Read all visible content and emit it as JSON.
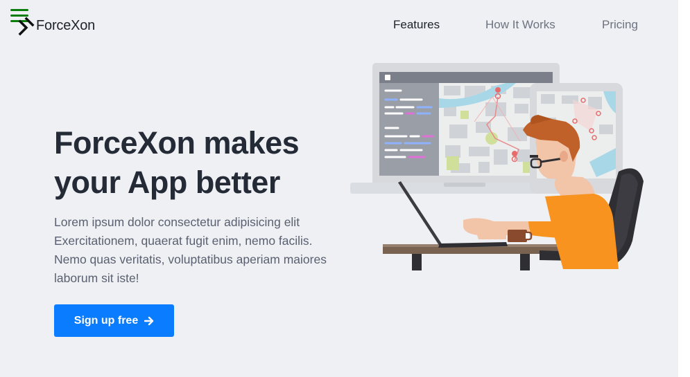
{
  "brand": {
    "name": "ForceXon"
  },
  "nav": {
    "items": [
      {
        "label": "Features",
        "active": true
      },
      {
        "label": "How It Works",
        "active": false
      },
      {
        "label": "Pricing",
        "active": false
      }
    ]
  },
  "hero": {
    "title_line1": "ForceXon makes",
    "title_line2": "your App better",
    "description": "Lorem ipsum dolor consectetur adipisicing elit Exercitationem, quaerat fugit enim, nemo facilis. Nemo quas veritatis, voluptatibus aperiam maiores laborum sit iste!",
    "cta_label": "Sign up free"
  },
  "colors": {
    "accent": "#0a7cff",
    "menu_icon": "#0a7d0a",
    "heading": "#242b36",
    "body_text": "#5a6070",
    "background": "#eef0f4"
  },
  "icons": {
    "menu": "hamburger-icon",
    "logo": "logo-chevron-icon",
    "cta": "arrow-right-icon"
  }
}
